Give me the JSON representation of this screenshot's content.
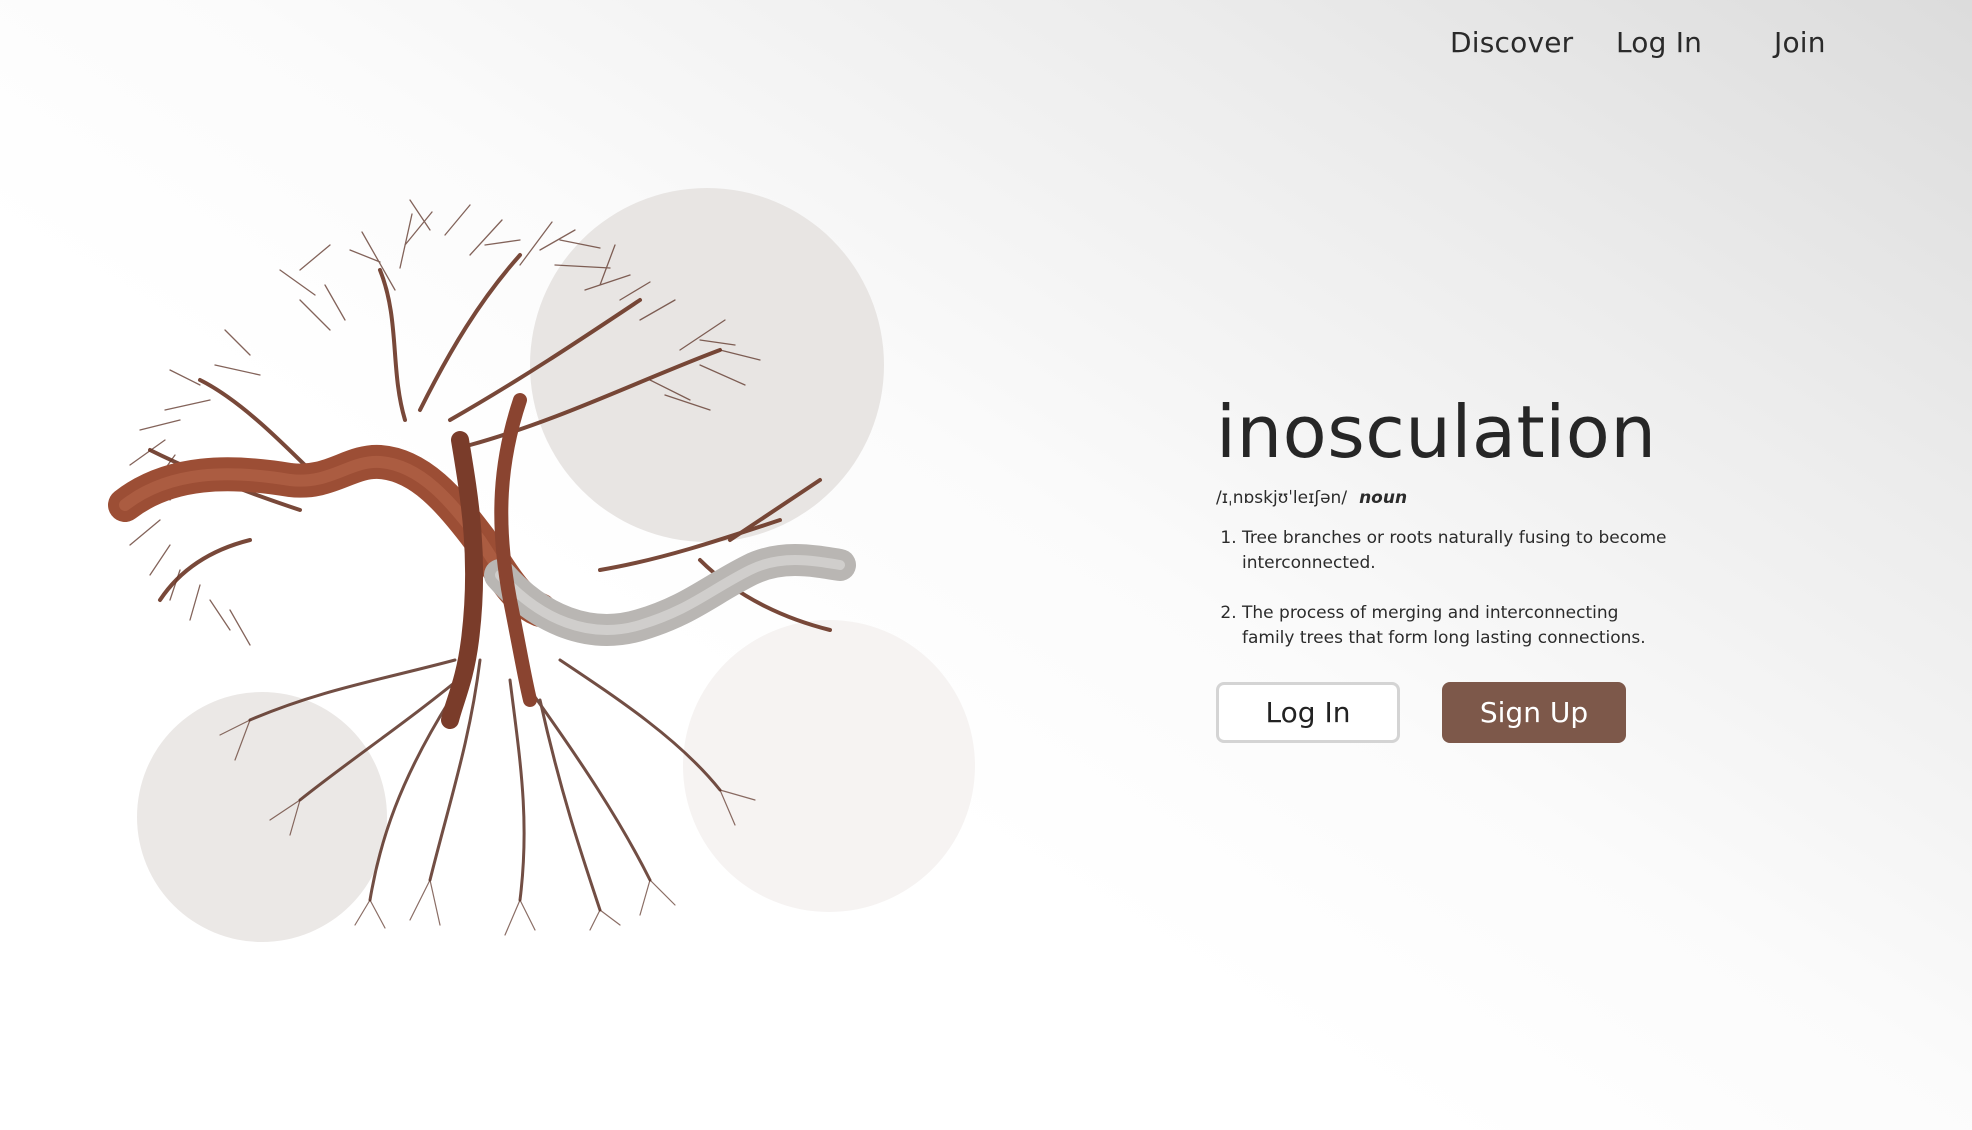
{
  "nav": {
    "discover": "Discover",
    "login": "Log In",
    "join": "Join"
  },
  "definition": {
    "word": "inosculation",
    "pronunciation": "/ɪˌnɒskjʊˈleɪʃən/",
    "part_of_speech": "noun",
    "meanings": [
      "Tree branches or roots naturally fusing to become interconnected.",
      "The process of merging and interconnecting family trees that form long lasting connections."
    ]
  },
  "actions": {
    "login_label": "Log In",
    "signup_label": "Sign Up"
  },
  "colors": {
    "accent": "#7d584a",
    "circle": "#e8e5e3",
    "branch": "#5a3024",
    "bark": "#9c4e35",
    "pale_bark": "#b9b6b3"
  },
  "hero": {
    "image": "intertwined-tree-illustration"
  }
}
